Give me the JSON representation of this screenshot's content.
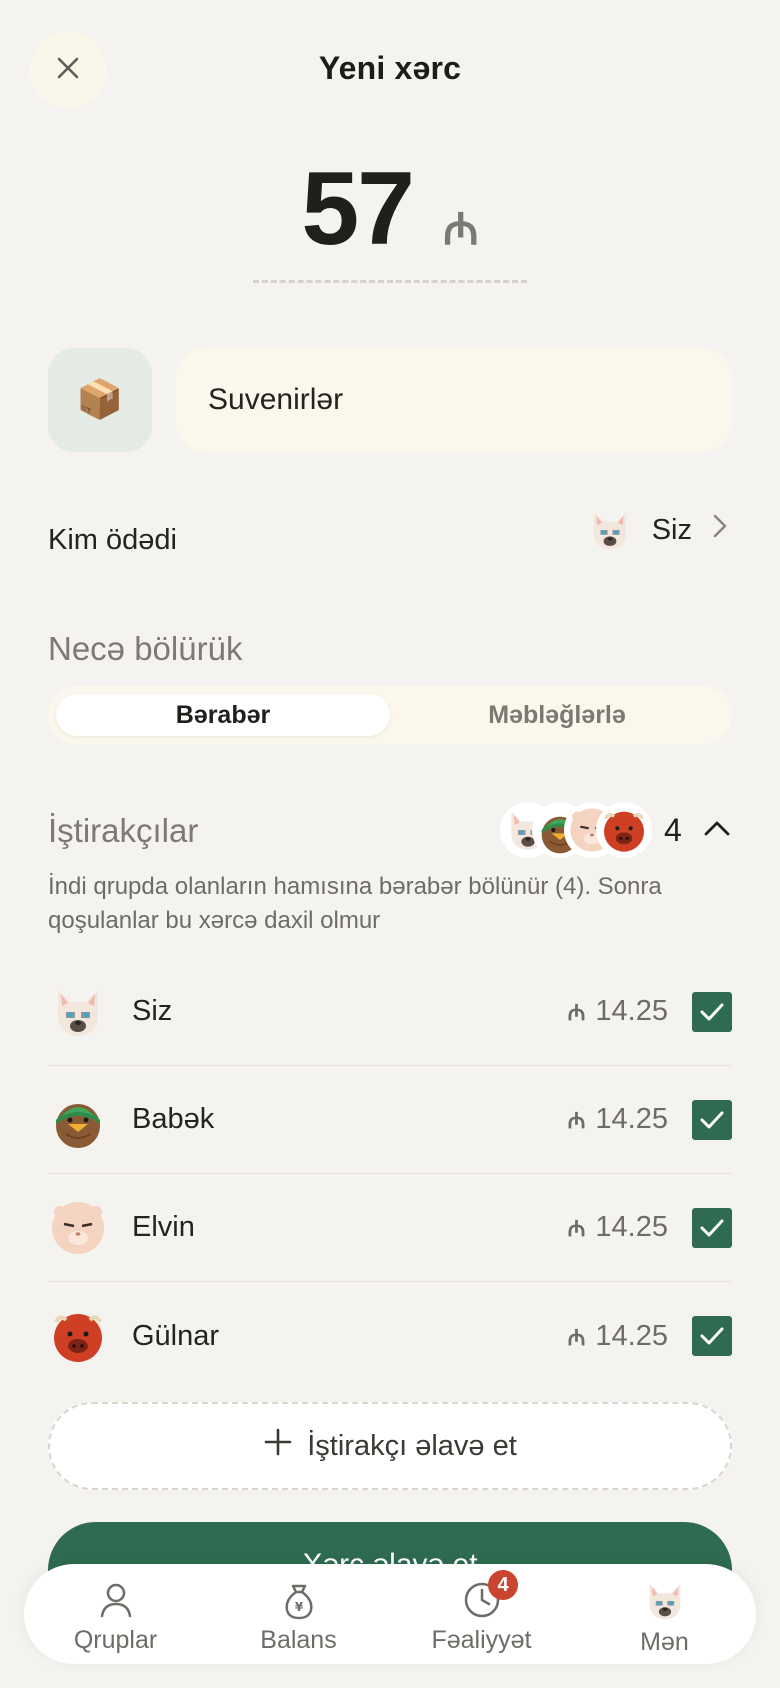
{
  "header": {
    "title": "Yeni xərc"
  },
  "amount": {
    "value": "57",
    "currency": "₼"
  },
  "category": {
    "icon": "package-icon",
    "emoji": "📦"
  },
  "description": {
    "value": "Suvenirlər"
  },
  "payer": {
    "label": "Kim ödədi",
    "value": "Siz"
  },
  "split": {
    "label": "Necə bölürük",
    "options": [
      "Bərabər",
      "Məbləğlərlə"
    ],
    "selected": "Bərabər"
  },
  "participants": {
    "label": "İştirakçılar",
    "count": "4",
    "note": "İndi qrupda olanların hamısına bərabər bölünür (4). Sonra qoşulanlar bu xərcə daxil olmur",
    "items": [
      {
        "name": "Siz",
        "currency": "₼",
        "amount": "14.25",
        "checked": true,
        "avatar": "cat-avatar"
      },
      {
        "name": "Babək",
        "currency": "₼",
        "amount": "14.25",
        "checked": true,
        "avatar": "duck-avatar"
      },
      {
        "name": "Elvin",
        "currency": "₼",
        "amount": "14.25",
        "checked": true,
        "avatar": "hamster-avatar"
      },
      {
        "name": "Gülnar",
        "currency": "₼",
        "amount": "14.25",
        "checked": true,
        "avatar": "bison-avatar"
      }
    ],
    "add_label": "İştirakçı əlavə et"
  },
  "primary_button": {
    "label": "Xərc əlavə et"
  },
  "tabs": [
    {
      "label": "Qruplar",
      "icon": "person-icon"
    },
    {
      "label": "Balans",
      "icon": "money-bag-icon"
    },
    {
      "label": "Fəaliyyət",
      "icon": "clock-icon",
      "badge": "4"
    },
    {
      "label": "Mən",
      "icon": "cat-avatar"
    }
  ],
  "colors": {
    "background": "#f5f3ef",
    "accent": "#2e6b51",
    "badge": "#c9452f"
  }
}
